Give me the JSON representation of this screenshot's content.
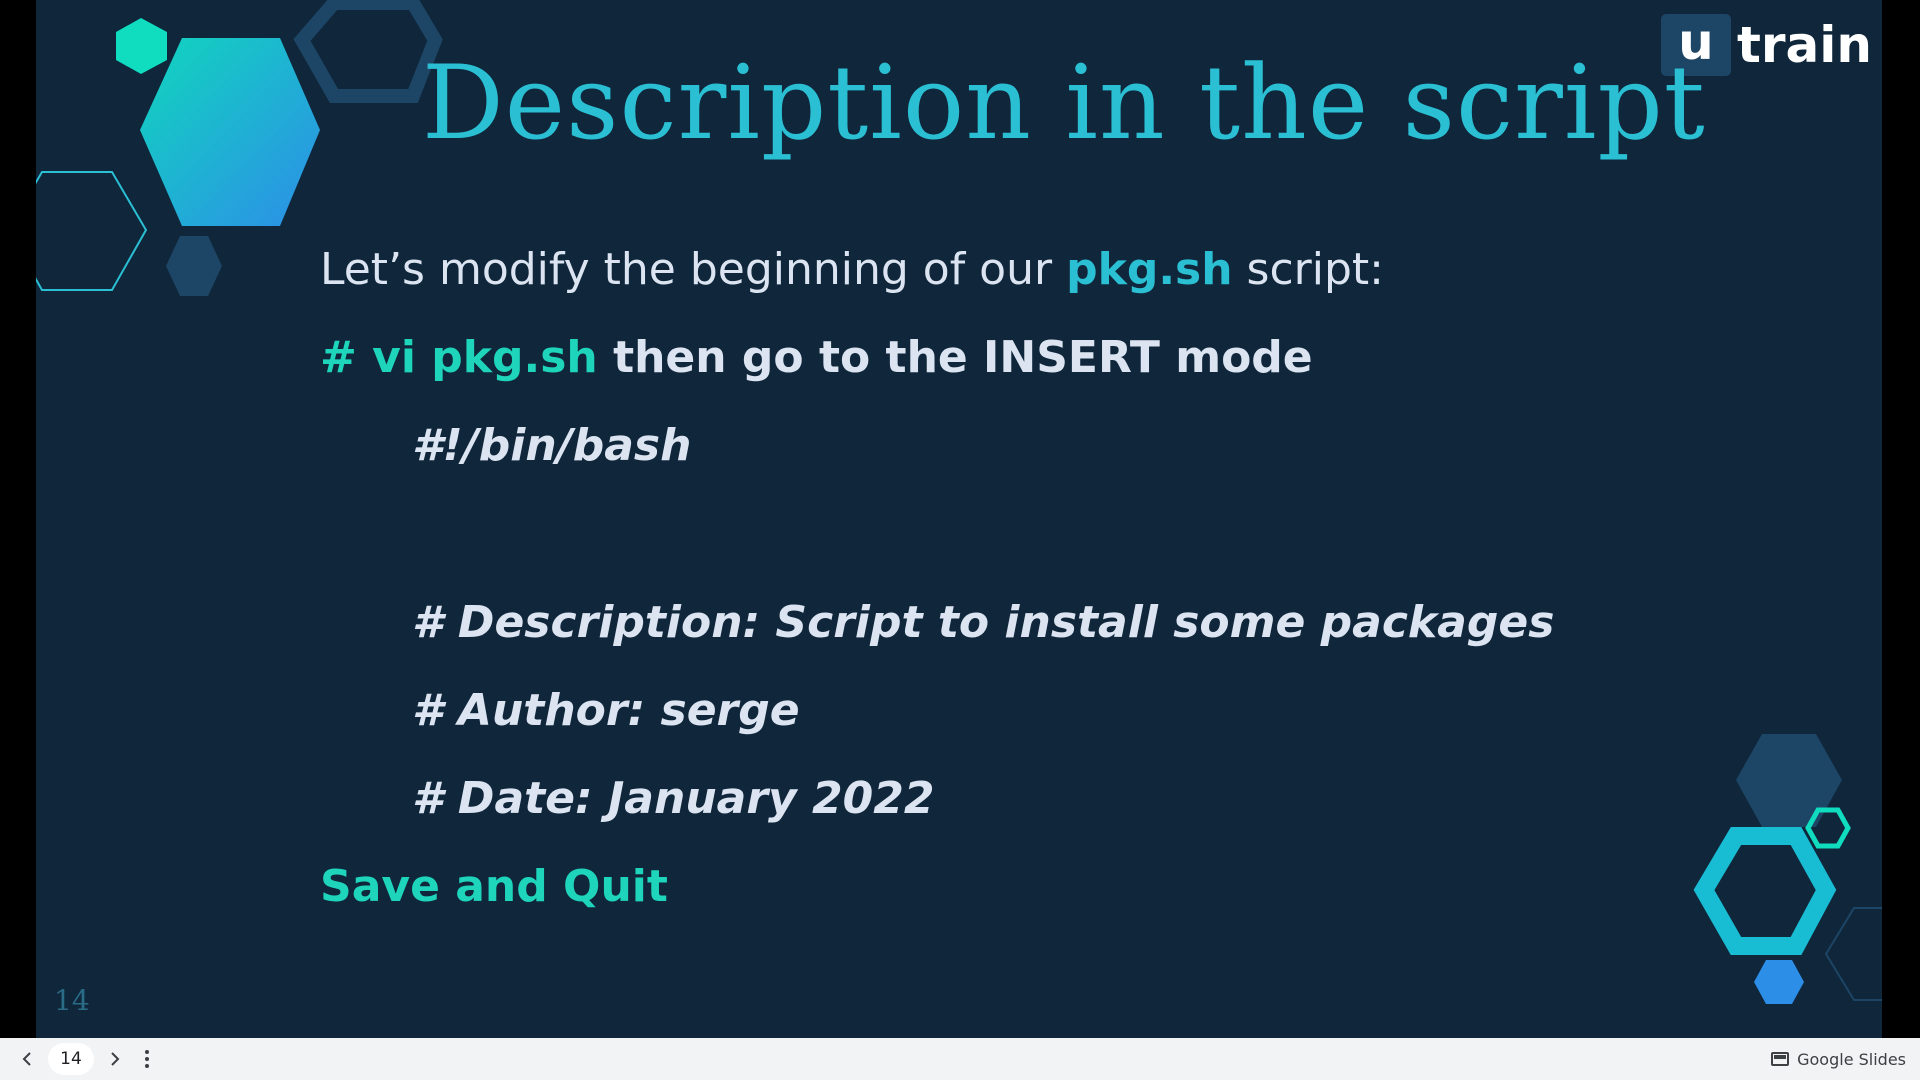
{
  "slide": {
    "title": "Description in the script",
    "logo": {
      "mark": "u",
      "word": "train"
    },
    "line1": {
      "before": "Let’s modify the beginning of our ",
      "highlight": "pkg.sh",
      "after": " script:"
    },
    "line2": {
      "highlight": "# vi pkg.sh",
      "after": " then go to the INSERT mode"
    },
    "code_lines": [
      "#!/bin/bash",
      "# Description: Script to install some packages",
      "# Author: serge",
      "# Date: January 2022"
    ],
    "closing": "Save and Quit",
    "slide_number": "14",
    "colors": {
      "background": "#0f263b",
      "accent_blue": "#2bbfd3",
      "accent_green": "#1ed4ba",
      "text": "#dbe4f0"
    }
  },
  "bottom_bar": {
    "prev_icon": "chevron-left-icon",
    "current_page": "14",
    "next_icon": "chevron-right-icon",
    "more_icon": "more-vert-icon",
    "brand": "Google Slides"
  }
}
